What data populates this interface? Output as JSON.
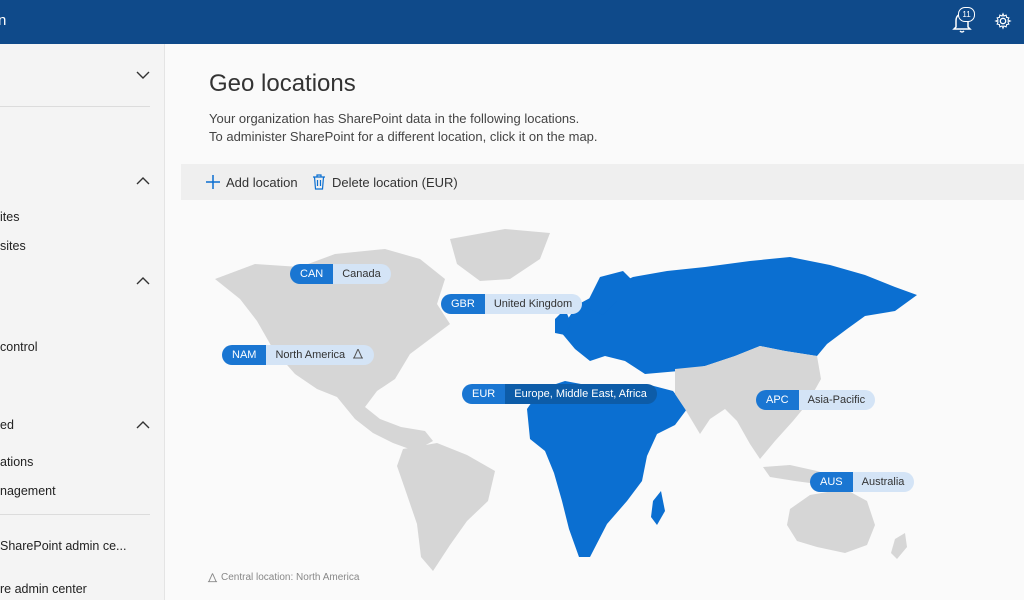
{
  "header": {
    "app_title": "n",
    "notification_count": "11"
  },
  "sidebar": {
    "items": [
      {
        "label": "ites"
      },
      {
        "label": "sites"
      },
      {
        "label": "control"
      },
      {
        "label": "ed"
      },
      {
        "label": "ations"
      },
      {
        "label": "nagement"
      },
      {
        "label": "SharePoint admin ce..."
      },
      {
        "label": "re admin center"
      }
    ]
  },
  "page": {
    "title": "Geo locations",
    "description_line1": "Your organization has SharePoint data in the following locations.",
    "description_line2": "To administer SharePoint for a different location, click it on the map."
  },
  "toolbar": {
    "add_label": "Add location",
    "delete_label": "Delete location (EUR)"
  },
  "locations": [
    {
      "code": "CAN",
      "name": "Canada"
    },
    {
      "code": "GBR",
      "name": "United Kingdom"
    },
    {
      "code": "NAM",
      "name": "North America",
      "central": true
    },
    {
      "code": "EUR",
      "name": "Europe, Middle East, Africa",
      "selected": true
    },
    {
      "code": "APC",
      "name": "Asia-Pacific"
    },
    {
      "code": "AUS",
      "name": "Australia"
    }
  ],
  "footer": {
    "central_location": "Central location: North America"
  },
  "colors": {
    "header_bg": "#0f4a8a",
    "region_selected": "#0b6fd1",
    "region_other": "#d6d6d6",
    "pill_code": "#1a76d2",
    "pill_name": "#d4e4f6"
  }
}
